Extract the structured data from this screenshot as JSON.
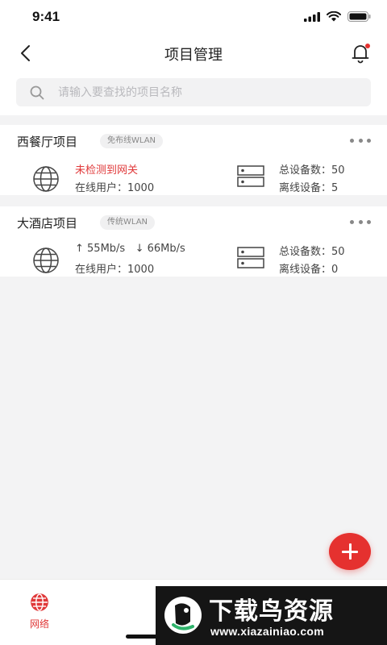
{
  "status_bar": {
    "time": "9:41"
  },
  "nav": {
    "title": "项目管理"
  },
  "search": {
    "placeholder": "请输入要查找的项目名称"
  },
  "projects": [
    {
      "name": "西餐厅项目",
      "badge": "免布线WLAN",
      "status_text": "未检测到网关",
      "online_users": "在线用户：1000",
      "total_devices": "总设备数：50",
      "offline_devices": "离线设备：5"
    },
    {
      "name": "大酒店项目",
      "badge": "传统WLAN",
      "upload_speed": "↑ 55Mb/s",
      "download_speed": "↓ 66Mb/s",
      "online_users": "在线用户：1000",
      "total_devices": "总设备数：50",
      "offline_devices": "离线设备：0"
    }
  ],
  "tabs": [
    {
      "label": "网络",
      "icon": "globe-icon"
    }
  ],
  "watermark": {
    "title": "下载鸟资源",
    "url": "www.xiazainiao.com"
  },
  "colors": {
    "accent": "#e5312f",
    "background": "#f3f3f4"
  }
}
